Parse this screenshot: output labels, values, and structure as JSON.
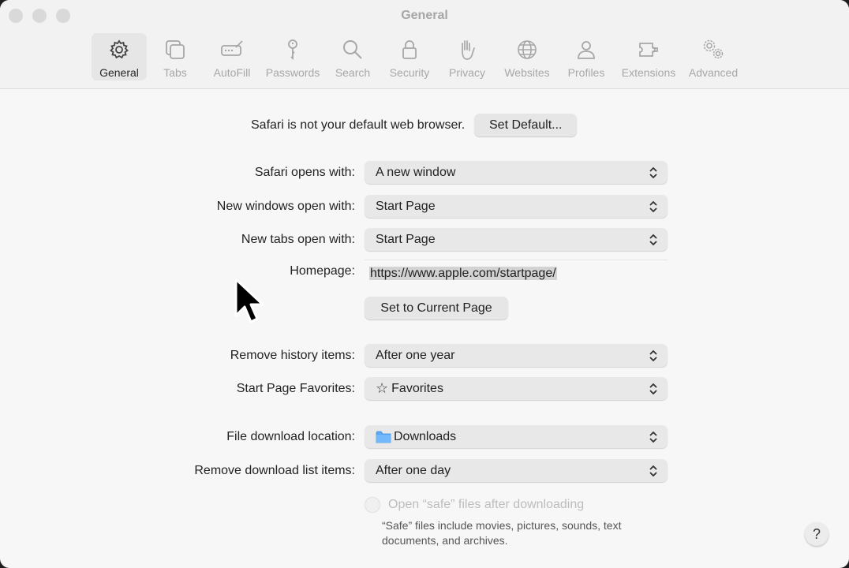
{
  "window": {
    "title": "General"
  },
  "toolbar": {
    "items": [
      {
        "label": "General",
        "icon": "gear-icon",
        "active": true
      },
      {
        "label": "Tabs",
        "icon": "tabs-icon"
      },
      {
        "label": "AutoFill",
        "icon": "autofill-icon"
      },
      {
        "label": "Passwords",
        "icon": "key-icon"
      },
      {
        "label": "Search",
        "icon": "search-icon"
      },
      {
        "label": "Security",
        "icon": "lock-icon"
      },
      {
        "label": "Privacy",
        "icon": "hand-icon"
      },
      {
        "label": "Websites",
        "icon": "globe-icon"
      },
      {
        "label": "Profiles",
        "icon": "person-icon"
      },
      {
        "label": "Extensions",
        "icon": "puzzle-icon"
      },
      {
        "label": "Advanced",
        "icon": "gears-icon"
      }
    ]
  },
  "default_browser": {
    "message": "Safari is not your default web browser.",
    "button": "Set Default..."
  },
  "settings": {
    "opens_with": {
      "label": "Safari opens with:",
      "value": "A new window"
    },
    "new_windows": {
      "label": "New windows open with:",
      "value": "Start Page"
    },
    "new_tabs": {
      "label": "New tabs open with:",
      "value": "Start Page"
    },
    "homepage": {
      "label": "Homepage:",
      "value": "https://www.apple.com/startpage/",
      "button": "Set to Current Page"
    },
    "remove_history": {
      "label": "Remove history items:",
      "value": "After one year"
    },
    "favorites": {
      "label": "Start Page Favorites:",
      "value": "Favorites"
    },
    "download_location": {
      "label": "File download location:",
      "value": "Downloads"
    },
    "remove_download": {
      "label": "Remove download list items:",
      "value": "After one day"
    },
    "open_safe": {
      "label": "Open “safe” files after downloading",
      "checked": false
    },
    "safe_note": "“Safe” files include movies, pictures, sounds, text documents, and archives."
  },
  "help": {
    "label": "?"
  },
  "colors": {
    "folder": "#5aa9f5",
    "popup": "#e8e8e8",
    "active_tab": "#e6e6e6"
  }
}
